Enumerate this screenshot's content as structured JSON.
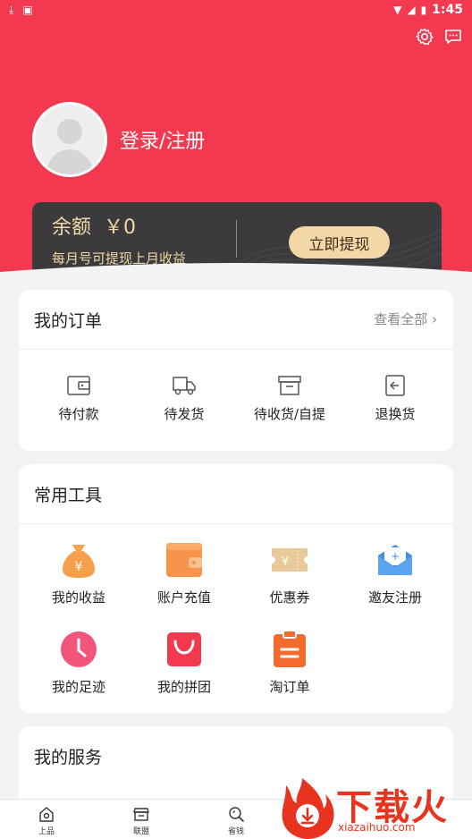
{
  "status_bar": {
    "time": "1:45"
  },
  "header": {
    "login_label": "登录/注册"
  },
  "balance": {
    "label": "余额",
    "amount": "￥0",
    "subtitle": "每月号可提现上月收益",
    "withdraw_button": "立即提现"
  },
  "orders": {
    "title": "我的订单",
    "view_all": "查看全部",
    "items": [
      {
        "label": "待付款",
        "icon": "wallet-icon"
      },
      {
        "label": "待发货",
        "icon": "truck-icon"
      },
      {
        "label": "待收货/自提",
        "icon": "box-icon"
      },
      {
        "label": "退换货",
        "icon": "return-icon"
      }
    ]
  },
  "tools": {
    "title": "常用工具",
    "items": [
      {
        "label": "我的收益",
        "icon": "money-bag-icon",
        "color": "#f7a04b"
      },
      {
        "label": "账户充值",
        "icon": "wallet-icon",
        "color": "#f7934a"
      },
      {
        "label": "优惠券",
        "icon": "coupon-icon",
        "color": "#e9c999"
      },
      {
        "label": "邀友注册",
        "icon": "mail-icon",
        "color": "#3e8ee6"
      },
      {
        "label": "我的足迹",
        "icon": "clock-icon",
        "color": "#f1557a"
      },
      {
        "label": "我的拼团",
        "icon": "shopping-bag-icon",
        "color": "#f2394f"
      },
      {
        "label": "淘订单",
        "icon": "clipboard-icon",
        "color": "#f46a2e"
      }
    ]
  },
  "services": {
    "title": "我的服务"
  },
  "tabbar": {
    "items": [
      {
        "label": "上品",
        "icon": "home-icon"
      },
      {
        "label": "联盟",
        "icon": "store-icon"
      },
      {
        "label": "省钱",
        "icon": "search-icon"
      }
    ]
  },
  "watermark": {
    "text": "下载火",
    "url": "xiazaihuo.com"
  },
  "colors": {
    "primary": "#f2394f",
    "card_dark": "#3b3b3d",
    "gold": "#f2d8a6"
  }
}
